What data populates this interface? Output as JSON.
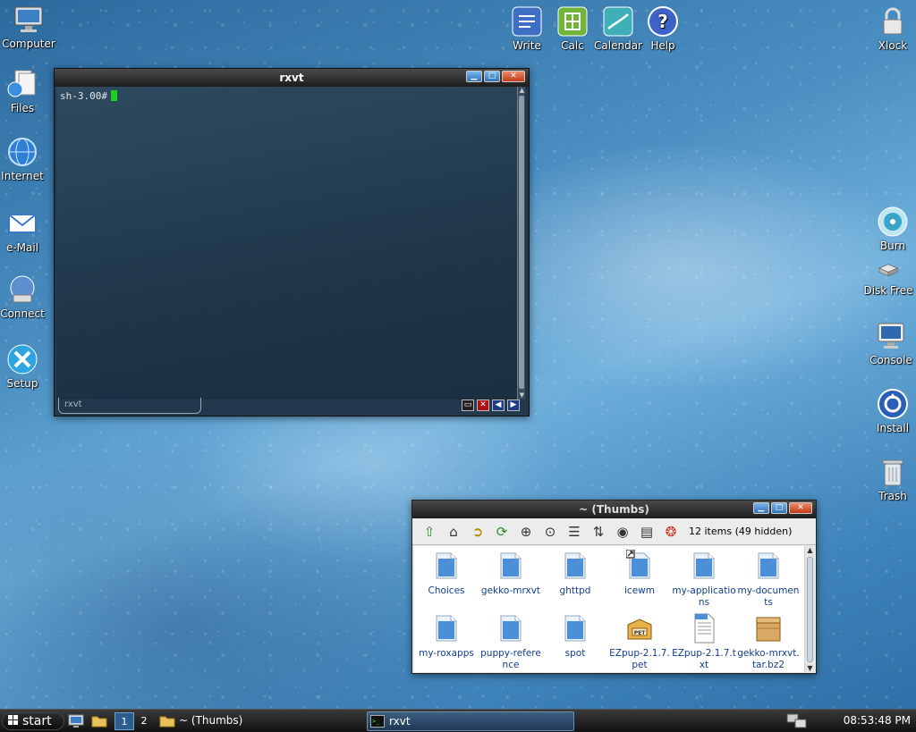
{
  "desktop": {
    "left_icons": [
      {
        "label": "Computer",
        "icon": "computer-icon"
      },
      {
        "label": "Files",
        "icon": "files-icon"
      },
      {
        "label": "Internet",
        "icon": "globe-icon"
      },
      {
        "label": "e-Mail",
        "icon": "mail-icon"
      },
      {
        "label": "Connect",
        "icon": "connect-icon"
      },
      {
        "label": "Setup",
        "icon": "tools-icon"
      }
    ],
    "top_icons": [
      {
        "label": "Write",
        "icon": "write-icon"
      },
      {
        "label": "Calc",
        "icon": "calc-icon"
      },
      {
        "label": "Calendar",
        "icon": "calendar-icon"
      },
      {
        "label": "Help",
        "icon": "help-icon"
      }
    ],
    "right_icons": [
      {
        "label": "Xlock",
        "icon": "lock-icon"
      },
      {
        "label": "Burn",
        "icon": "cd-icon"
      },
      {
        "label": "Disk Free",
        "icon": "disk-icon"
      },
      {
        "label": "Console",
        "icon": "monitor-icon"
      },
      {
        "label": "Install",
        "icon": "install-icon"
      },
      {
        "label": "Trash",
        "icon": "trash-icon"
      }
    ]
  },
  "rxvt": {
    "title": "rxvt",
    "prompt": "sh-3.00#",
    "tab_label": "rxvt"
  },
  "thumbs": {
    "title": "~ (Thumbs)",
    "count": "12 items (49 hidden)",
    "files": [
      {
        "name": "Choices",
        "kind": "folder"
      },
      {
        "name": "gekko-mrxvt",
        "kind": "folder"
      },
      {
        "name": "ghttpd",
        "kind": "folder"
      },
      {
        "name": "icewm",
        "kind": "folder-link"
      },
      {
        "name": "my-applications",
        "kind": "folder"
      },
      {
        "name": "my-documents",
        "kind": "folder"
      },
      {
        "name": "my-roxapps",
        "kind": "folder"
      },
      {
        "name": "puppy-reference",
        "kind": "folder"
      },
      {
        "name": "spot",
        "kind": "folder"
      },
      {
        "name": "EZpup-2.1.7.pet",
        "kind": "pet-package"
      },
      {
        "name": "EZpup-2.1.7.txt",
        "kind": "text-file"
      },
      {
        "name": "gekko-mrxvt.tar.bz2",
        "kind": "archive"
      }
    ]
  },
  "taskbar": {
    "start_label": "start",
    "workspaces": [
      "1",
      "2"
    ],
    "tasks": [
      {
        "label": "~ (Thumbs)"
      },
      {
        "label": "rxvt"
      }
    ],
    "clock": "08:53:48 PM"
  },
  "colors": {
    "accent": "#2f72b8",
    "close": "#c23a16",
    "cursor": "#19d219",
    "file_label": "#123e8a"
  }
}
